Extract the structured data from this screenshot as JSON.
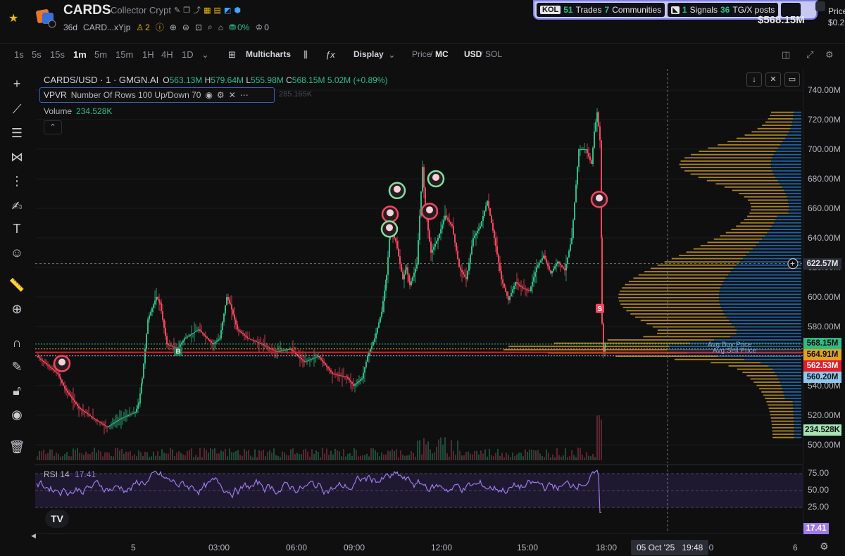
{
  "header": {
    "symbol": "CARDS",
    "name": "Collector Crypt",
    "age": "36d",
    "address": "CARD...xYjp",
    "holders_count": "2",
    "holder_change": "0%",
    "likes": "0",
    "price_partial": "$568.15M",
    "right_price_label": "Price",
    "right_price_value": "$0.2"
  },
  "kol_bar": {
    "tag": "KOL",
    "trades_count": "51",
    "trades_label": "Trades",
    "communities_count": "7",
    "communities_label": "Communities",
    "signals_count": "1",
    "signals_label": "Signals",
    "posts_count": "36",
    "posts_label": "TG/X posts"
  },
  "toolbar": {
    "timeframes": [
      "1s",
      "5s",
      "15s",
      "1m",
      "5m",
      "15m",
      "1H",
      "4H",
      "1D"
    ],
    "active_timeframe": "1m",
    "multicharts_label": "Multicharts",
    "display_label": "Display",
    "price_label": "Price",
    "mc_label": "MC",
    "usd_label": "USD",
    "sol_label": "SOL"
  },
  "legend": {
    "pair": "CARDS/USD · 1 · GMGN.AI",
    "o_label": "O",
    "o": "563.13M",
    "h_label": "H",
    "h": "579.64M",
    "l_label": "L",
    "l": "555.98M",
    "c_label": "C",
    "c": "568.15M",
    "change": "5.02M (+0.89%)",
    "vpvr_name": "VPVR",
    "vpvr_params": "Number Of Rows 100 Up/Down 70",
    "vpvr_ghost": "285.165K",
    "volume_label": "Volume",
    "volume_value": "234.528K"
  },
  "price_axis": {
    "ticks": [
      "740.00M",
      "720.00M",
      "700.00M",
      "680.00M",
      "660.00M",
      "640.00M",
      "620.00M",
      "600.00M",
      "580.00M",
      "560.00M",
      "540.00M",
      "520.00M",
      "500.00M"
    ],
    "labels": [
      {
        "text": "622.57M",
        "kind": "crosshair",
        "bg": "#2a2d36",
        "fg": "#e6e6e6"
      },
      {
        "text": "568.15M",
        "kind": "last",
        "bg": "#2ebd85",
        "fg": "#0f0f10"
      },
      {
        "text": "564.91M",
        "kind": "poc",
        "bg": "#e0a31f",
        "fg": "#0f0f10"
      },
      {
        "text": "562.53M",
        "kind": "line",
        "bg": "#e01e2b",
        "fg": "#ffffff"
      },
      {
        "text": "560.20M",
        "kind": "avg",
        "bg": "#8fc8ef",
        "fg": "#0f0f10"
      },
      {
        "text": "234.528K",
        "kind": "volume",
        "bg": "#a6e3b5",
        "fg": "#0f0f10"
      }
    ]
  },
  "rsi": {
    "label": "RSI",
    "period": "14",
    "value": "17.41",
    "ticks": [
      "75.00",
      "50.00",
      "25.00"
    ]
  },
  "time_axis": {
    "ticks": [
      "5",
      "03:00",
      "06:00",
      "09:00",
      "12:00",
      "15:00",
      "18:00",
      "00",
      "6"
    ],
    "crosshair_date": "05 Oct '25",
    "crosshair_time": "19:48"
  },
  "chart_overlays": {
    "avg_buy_label": "Avg Buy Price",
    "avg_sell_label": "Avg Sell Price",
    "buy_marker": "B",
    "sell_marker": "S",
    "tv_logo": "TV"
  },
  "colors": {
    "up": "#2ebd85",
    "down": "#f6465d",
    "vp_blue": "#1f6fb5",
    "vp_gold": "#c99a22",
    "rsi": "#9f7aea"
  }
}
